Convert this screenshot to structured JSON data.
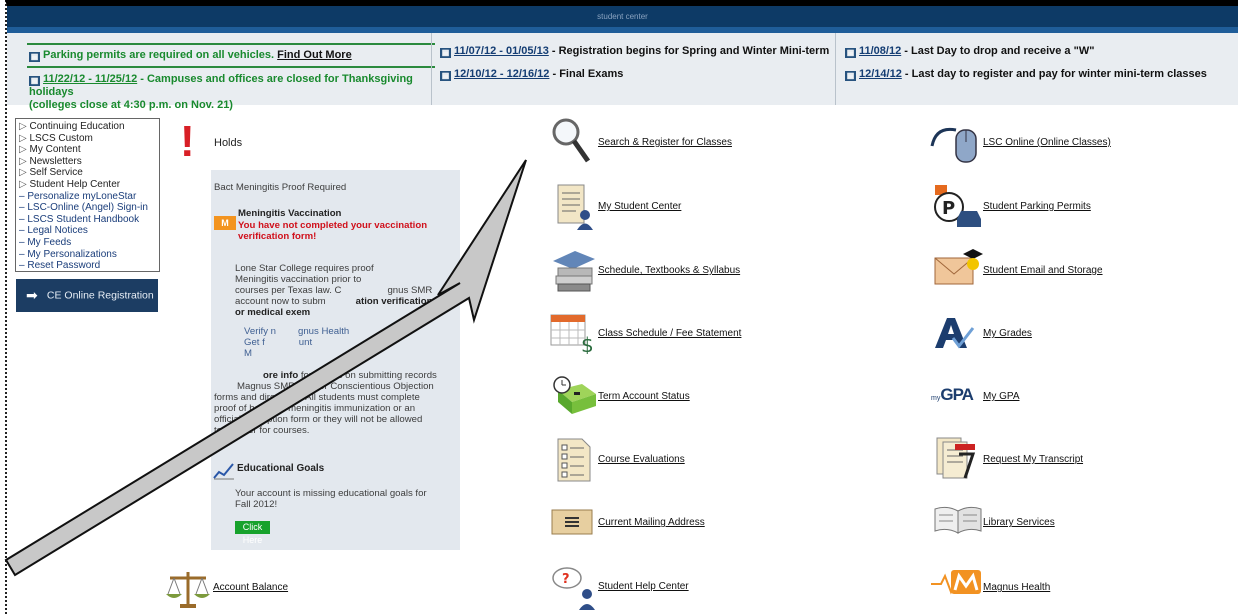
{
  "header": {
    "title": "student center"
  },
  "announcements": {
    "parking": {
      "text": "Parking permits are required on all vehicles.",
      "link": "Find Out More"
    },
    "holiday": {
      "dates": "11/22/12 - 11/25/12",
      "text": " - Campuses and offices are closed for Thanksgiving holidays",
      "text2": "(colleges close at 4:30 p.m. on Nov. 21)"
    },
    "news": [
      {
        "dates": "11/07/12 - 01/05/13",
        "text": " - Registration begins for Spring and Winter Mini-term"
      },
      {
        "dates": "12/10/12 - 12/16/12",
        "text": " - Final Exams"
      },
      {
        "dates": "11/08/12",
        "text": " - Last Day to drop and receive a \"W\""
      },
      {
        "dates": "12/14/12",
        "text": " - Last day to register and pay for winter mini-term classes"
      }
    ]
  },
  "sidebar": {
    "items": [
      "Continuing Education",
      "LSCS Custom",
      "My Content",
      "Newsletters",
      "Self Service",
      "Student Help Center",
      "Personalize myLoneStar",
      "LSC-Online (Angel) Sign-in",
      "LSCS Student Handbook",
      "Legal Notices",
      "My Feeds",
      "My Personalizations",
      "Reset Password"
    ],
    "ce_button": "CE Online Registration"
  },
  "holds": {
    "label": "Holds",
    "panel_title": "Bact Meningitis Proof Required",
    "mv_title": "Meningitis Vaccination",
    "mv_warning1": "You have not completed your vaccination",
    "mv_warning2": "verification form!",
    "mag_logo": "M",
    "body1": "Lone Star College requires proof",
    "body2": "Meningitis vaccination prior to",
    "body3": "courses per Texas law. C",
    "body3b": "gnus SMR",
    "body4": "account now to subm",
    "body4b": "ation verification",
    "body5": "or medical exem",
    "link1": "Verify n",
    "link1b": "gnus Health",
    "link2": "Get f",
    "link2b": "unt",
    "link3": "M",
    "more_bold": "ore info",
    "more1": " for details on submitting records",
    "more2": "Magnus SMR and for Conscientious Objection",
    "more3": "forms and directions. All students must complete",
    "more4": "proof of bacterial meningitis immunization or an",
    "more5": "official exemption form or they will not be allowed",
    "more6": "to register for courses.",
    "eg_title": "Educational Goals",
    "eg_text1": "Your account is missing educational goals for",
    "eg_text2": "Fall 2012!",
    "eg_button": "Click Here"
  },
  "services": {
    "search": "Search & Register for Classes",
    "my_student_center": "My Student Center",
    "schedule_textbooks": "Schedule, Textbooks & Syllabus",
    "class_schedule": "Class Schedule / Fee Statement",
    "term_account": "Term Account Status",
    "course_eval": "Course Evaluations",
    "mailing": "Current Mailing Address",
    "help_center": "Student Help Center",
    "account_balance": "Account Balance",
    "lsc_online": "LSC Online (Online Classes)",
    "parking_permits": "Student Parking Permits",
    "email_storage": "Student Email and Storage",
    "my_grades": "My Grades",
    "gpa_logo": "GPA",
    "gpa_prefix": "my",
    "my_gpa": "My GPA",
    "transcript": "Request My Transcript",
    "library": "Library Services",
    "magnus": "Magnus Health",
    "fee_symbol": "$",
    "help_symbol": "?"
  }
}
